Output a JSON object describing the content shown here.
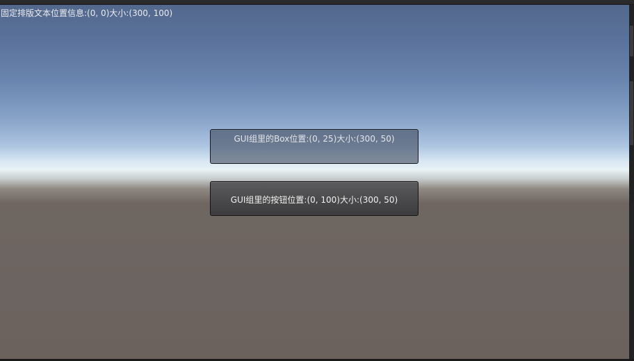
{
  "scene": {
    "fixed_label": "固定排版文本位置信息:(0, 0)大小:(300, 100)",
    "group_box_label": "GUI组里的Box位置:(0, 25)大小:(300, 50)",
    "group_button_label": "GUI组里的按钮位置:(0, 100)大小:(300, 50)"
  },
  "colors": {
    "sky_top": "#53688d",
    "horizon": "#eaf2f6",
    "ground": "#6b625e"
  }
}
